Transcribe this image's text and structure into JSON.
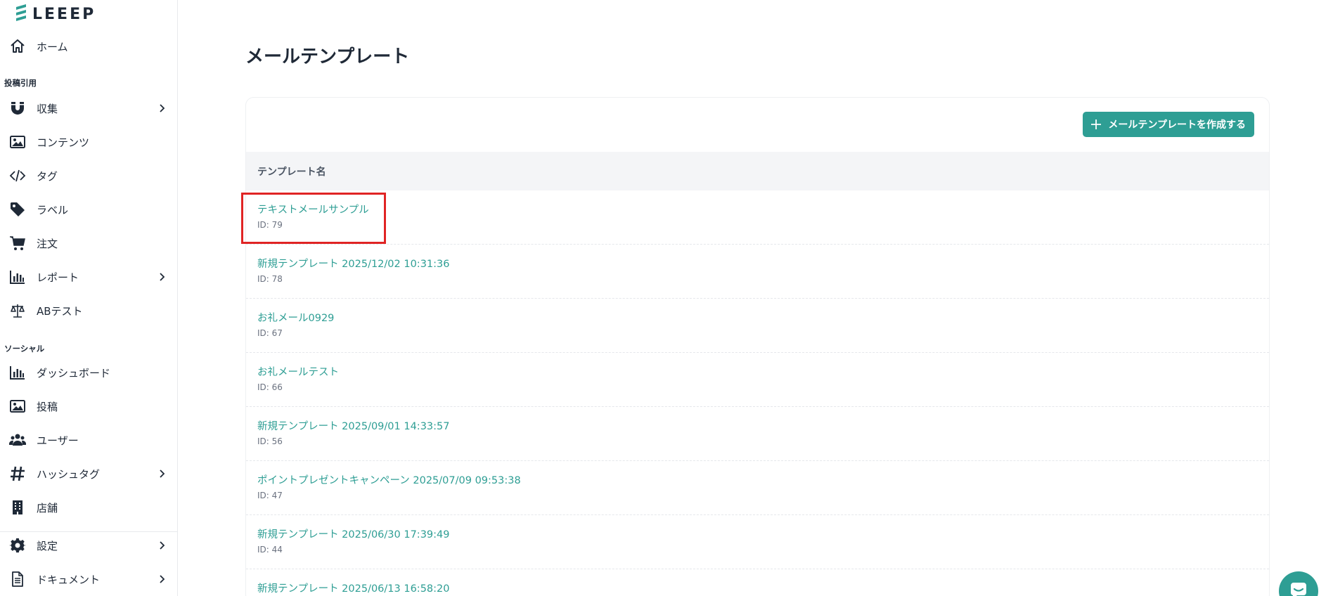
{
  "brand": {
    "name": "LEEEP",
    "accent": "#2e9e94"
  },
  "sidebar": {
    "home": {
      "label": "ホーム",
      "icon": "home-icon"
    },
    "sections": [
      {
        "title": "投稿引用"
      },
      {
        "title": "ソーシャル"
      }
    ],
    "items_post": [
      {
        "label": "収集",
        "icon": "magnet-icon",
        "expandable": true
      },
      {
        "label": "コンテンツ",
        "icon": "image-icon",
        "expandable": false
      },
      {
        "label": "タグ",
        "icon": "code-icon",
        "expandable": false
      },
      {
        "label": "ラベル",
        "icon": "tag-icon",
        "expandable": false
      },
      {
        "label": "注文",
        "icon": "cart-icon",
        "expandable": false
      },
      {
        "label": "レポート",
        "icon": "bar-chart-icon",
        "expandable": true
      },
      {
        "label": "ABテスト",
        "icon": "scale-icon",
        "expandable": false
      }
    ],
    "items_social": [
      {
        "label": "ダッシュボード",
        "icon": "bar-chart-icon",
        "expandable": false
      },
      {
        "label": "投稿",
        "icon": "image-icon",
        "expandable": false
      },
      {
        "label": "ユーザー",
        "icon": "users-icon",
        "expandable": false
      },
      {
        "label": "ハッシュタグ",
        "icon": "hashtag-icon",
        "expandable": true
      },
      {
        "label": "店舗",
        "icon": "building-icon",
        "expandable": false
      }
    ],
    "items_bottom": [
      {
        "label": "設定",
        "icon": "gear-icon",
        "expandable": true
      },
      {
        "label": "ドキュメント",
        "icon": "document-icon",
        "expandable": true
      }
    ]
  },
  "main": {
    "title": "メールテンプレート",
    "create_button": "メールテンプレートを作成する",
    "table": {
      "column_header": "テンプレート名",
      "rows": [
        {
          "name": "テキストメールサンプル",
          "id": "ID: 79"
        },
        {
          "name": "新規テンプレート 2025/12/02 10:31:36",
          "id": "ID: 78"
        },
        {
          "name": "お礼メール0929",
          "id": "ID: 67"
        },
        {
          "name": "お礼メールテスト",
          "id": "ID: 66"
        },
        {
          "name": "新規テンプレート 2025/09/01 14:33:57",
          "id": "ID: 56"
        },
        {
          "name": "ポイントプレゼントキャンペーン 2025/07/09 09:53:38",
          "id": "ID: 47"
        },
        {
          "name": "新規テンプレート 2025/06/30 17:39:49",
          "id": "ID: 44"
        },
        {
          "name": "新規テンプレート 2025/06/13 16:58:20",
          "id": ""
        }
      ]
    }
  }
}
